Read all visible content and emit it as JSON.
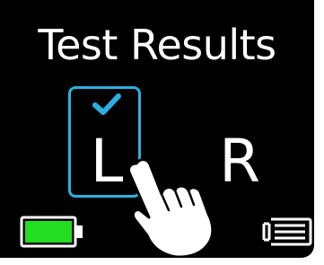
{
  "screen": {
    "title": "Test Results",
    "left_ear_label": "L",
    "right_ear_label": "R",
    "left_ear_selected": true,
    "right_ear_selected": false,
    "battery_level": 1.0
  },
  "icons": {
    "checkmark": "checkmark-icon",
    "hand": "tapping-hand-icon",
    "battery": "battery-full-icon",
    "menu": "menu-list-icon"
  },
  "colors": {
    "background": "#000000",
    "text": "#ffffff",
    "selection_accent": "#2ab0e0",
    "battery_fill": "#22dd22"
  }
}
